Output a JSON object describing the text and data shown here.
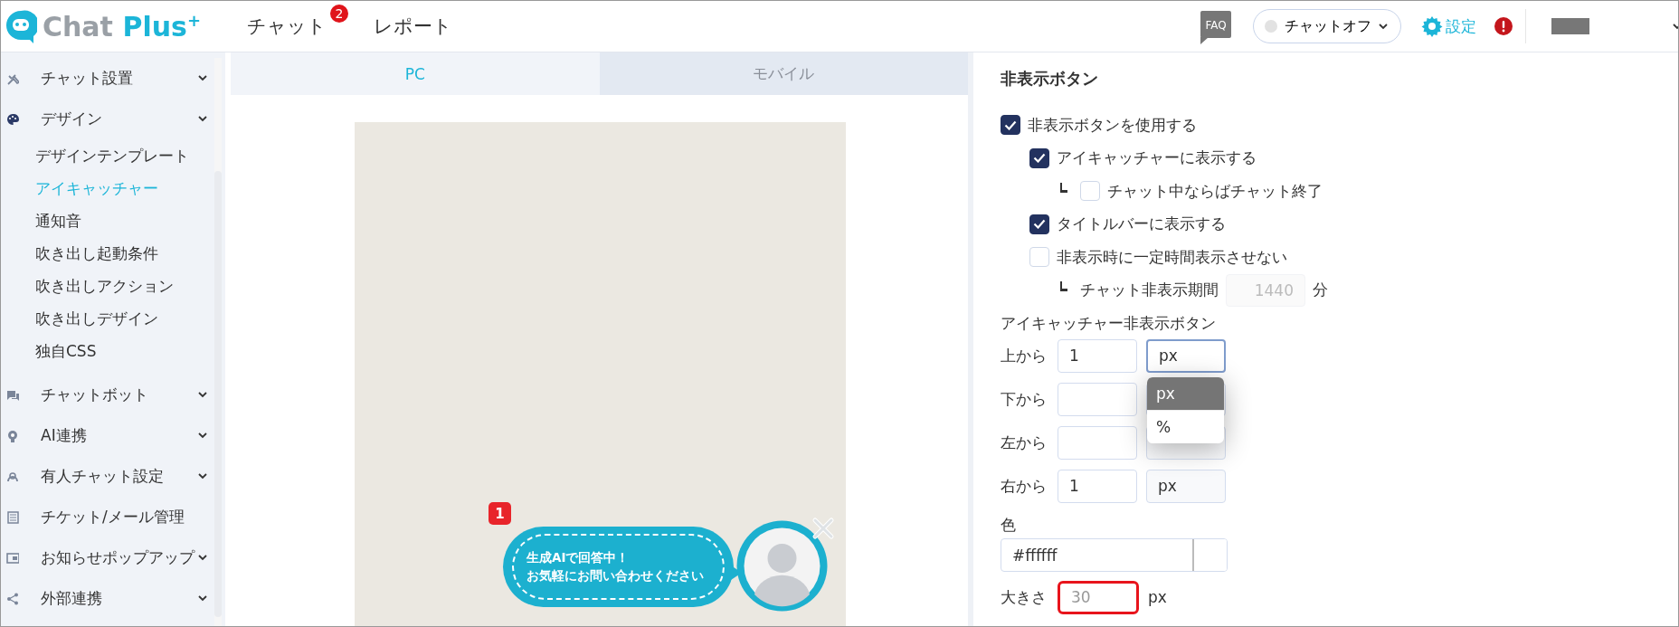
{
  "header": {
    "logo": {
      "name": "Chat",
      "accent": "Plus",
      "sup": "+"
    },
    "nav": [
      {
        "label": "チャット",
        "badge": "2"
      },
      {
        "label": "レポート"
      }
    ],
    "faq": "FAQ",
    "chat_status": {
      "label": "チャットオフ",
      "online": false
    },
    "settings_label": "設定"
  },
  "sidebar": {
    "items": [
      {
        "label": "チャット設置",
        "collapsible": true,
        "selected": false
      },
      {
        "label": "デザイン",
        "collapsible": true,
        "selected": false,
        "children": [
          {
            "label": "デザインテンプレート",
            "selected": false
          },
          {
            "label": "アイキャッチャー",
            "selected": true
          },
          {
            "label": "通知音",
            "selected": false
          },
          {
            "label": "吹き出し起動条件",
            "selected": false
          },
          {
            "label": "吹き出しアクション",
            "selected": false
          },
          {
            "label": "吹き出しデザイン",
            "selected": false
          },
          {
            "label": "独自CSS",
            "selected": false
          }
        ]
      },
      {
        "label": "チャットボット",
        "collapsible": true,
        "selected": false
      },
      {
        "label": "AI連携",
        "collapsible": true,
        "selected": false
      },
      {
        "label": "有人チャット設定",
        "collapsible": true,
        "selected": false
      },
      {
        "label": "チケット/メール管理",
        "collapsible": false,
        "selected": false
      },
      {
        "label": "お知らせポップアップ",
        "collapsible": true,
        "selected": false
      },
      {
        "label": "外部連携",
        "collapsible": true,
        "selected": false
      }
    ]
  },
  "preview": {
    "tabs": [
      {
        "label": "PC",
        "selected": true
      },
      {
        "label": "モバイル",
        "selected": false
      }
    ],
    "widget": {
      "badge": "1",
      "message_lines": [
        "生成AIで回答中！",
        "お気軽にお問い合わせください"
      ]
    }
  },
  "settings": {
    "title": "非表示ボタン",
    "options": [
      {
        "kind": "checkbox",
        "label": "非表示ボタンを使用する",
        "checked": true,
        "children": [
          {
            "kind": "checkbox",
            "label": "アイキャッチャーに表示する",
            "checked": true,
            "children": [
              {
                "kind": "checkbox",
                "label": "チャット中ならばチャット終了",
                "checked": false
              }
            ]
          },
          {
            "kind": "checkbox",
            "label": "タイトルバーに表示する",
            "checked": true
          },
          {
            "kind": "checkbox",
            "label": "非表示時に一定時間表示させない",
            "checked": false,
            "children": [
              {
                "kind": "number",
                "label": "チャット非表示期間",
                "placeholder": "1440",
                "unit": "分",
                "disabled": true
              }
            ]
          }
        ]
      }
    ],
    "position_title": "アイキャッチャー非表示ボタン",
    "positions": [
      {
        "label": "上から",
        "value": "1",
        "unit": "px",
        "focused": true
      },
      {
        "label": "下から",
        "focused": false
      },
      {
        "label": "左から",
        "focused": false
      },
      {
        "label": "右から",
        "value": "1",
        "unit": "px",
        "focused": false
      }
    ],
    "dropdown": [
      {
        "label": "px",
        "selected": true
      },
      {
        "label": "%",
        "selected": false
      }
    ],
    "color": {
      "label": "色",
      "value": "#ffffff"
    },
    "size": {
      "label": "大きさ",
      "placeholder": "30",
      "unit": "px",
      "highlighted": true
    }
  }
}
